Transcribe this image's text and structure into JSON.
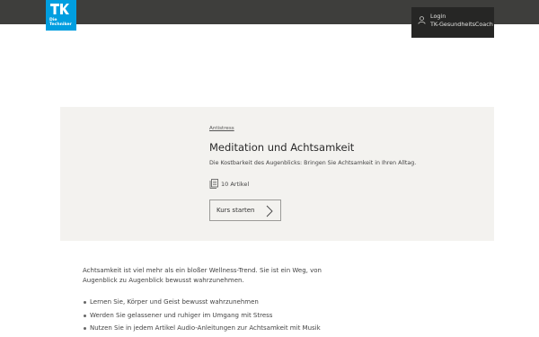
{
  "brand": {
    "line1": "Die",
    "line2": "Techniker",
    "color": "#009ee0"
  },
  "header": {
    "menu_items": [
      "Login",
      "TK-GesundheitsCoach"
    ],
    "user_icon": "user-icon"
  },
  "hero": {
    "topic": "Antistress",
    "title": "Meditation und Achtsamkeit",
    "description": "Die Kostbarkeit des Augenblicks: Bringen Sie Achtsamkeit in Ihren Alltag.",
    "article_count": "10 Artikel",
    "article_icon": "articles-icon",
    "start_button": "Kurs starten",
    "start_icon": "chevron-right-icon"
  },
  "content": {
    "intro": "Achtsamkeit ist viel mehr als ein bloßer Wellness-Trend. Sie ist ein Weg, von Augenblick zu Augenblick bewusst wahrzunehmen.",
    "bullets": [
      "Lernen Sie, Körper und Geist bewusst wahrzunehmen",
      "Werden Sie gelassener und ruhiger im Umgang mit Stress",
      "Nutzen Sie in jedem Artikel Audio-Anleitungen zur Achtsamkeit mit Musik"
    ]
  }
}
